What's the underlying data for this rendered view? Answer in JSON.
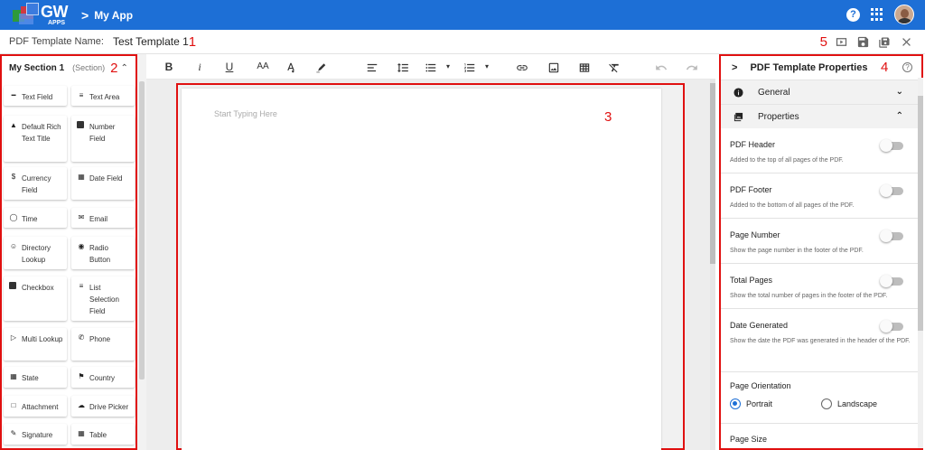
{
  "header": {
    "logo_text": "GW",
    "logo_sub": "APPS",
    "breadcrumb_sep": ">",
    "app_name": "My App"
  },
  "name_row": {
    "label": "PDF Template Name:",
    "value": "Test Template 1",
    "callout_1": "1",
    "callout_5": "5"
  },
  "left_panel": {
    "section_title": "My Section 1",
    "section_sub": "(Section)",
    "callout": "2",
    "fields": [
      {
        "label": "Text Field",
        "icon": "short-text-icon"
      },
      {
        "label": "Text Area",
        "icon": "long-text-icon"
      },
      {
        "label": "Default Rich Text Title",
        "icon": "rich-text-icon"
      },
      {
        "label": "Number Field",
        "icon": "number-icon"
      },
      {
        "label": "Currency Field",
        "icon": "dollar-icon"
      },
      {
        "label": "Date Field",
        "icon": "calendar-icon"
      },
      {
        "label": "Time",
        "icon": "stopwatch-icon"
      },
      {
        "label": "Email",
        "icon": "envelope-icon"
      },
      {
        "label": "Directory Lookup",
        "icon": "people-icon"
      },
      {
        "label": "Radio Button",
        "icon": "radio-icon"
      },
      {
        "label": "Checkbox",
        "icon": "checkbox-icon"
      },
      {
        "label": "List Selection Field",
        "icon": "list-icon"
      },
      {
        "label": "Multi Lookup",
        "icon": "multi-lookup-icon"
      },
      {
        "label": "Phone",
        "icon": "phone-icon"
      },
      {
        "label": "State",
        "icon": "map-icon"
      },
      {
        "label": "Country",
        "icon": "flag-icon"
      },
      {
        "label": "Attachment",
        "icon": "folder-icon"
      },
      {
        "label": "Drive Picker",
        "icon": "cloud-upload-icon"
      },
      {
        "label": "Signature",
        "icon": "signature-icon"
      },
      {
        "label": "Table",
        "icon": "table-icon"
      }
    ]
  },
  "toolbar": {
    "bold": "B",
    "italic": "i",
    "underline": "U",
    "font_size": "AA",
    "callout": "3"
  },
  "editor": {
    "placeholder": "Start Typing Here"
  },
  "right_panel": {
    "title": "PDF Template Properties",
    "callout": "4",
    "general_label": "General",
    "properties_label": "Properties",
    "props": [
      {
        "label": "PDF Header",
        "desc": "Added to the top of all pages of the PDF."
      },
      {
        "label": "PDF Footer",
        "desc": "Added to the bottom of all pages of the PDF."
      },
      {
        "label": "Page Number",
        "desc": "Show the page number in the footer of the PDF."
      },
      {
        "label": "Total Pages",
        "desc": "Show the total number of pages in the footer of the PDF."
      },
      {
        "label": "Date Generated",
        "desc": "Show the date the PDF was generated in the header of the PDF."
      }
    ],
    "orientation_label": "Page Orientation",
    "orientation_options": [
      "Portrait",
      "Landscape"
    ],
    "orientation_selected": "Portrait",
    "page_size_label": "Page Size"
  },
  "colors": {
    "brand_blue": "#1d6fd6",
    "callout_red": "#e01010"
  }
}
